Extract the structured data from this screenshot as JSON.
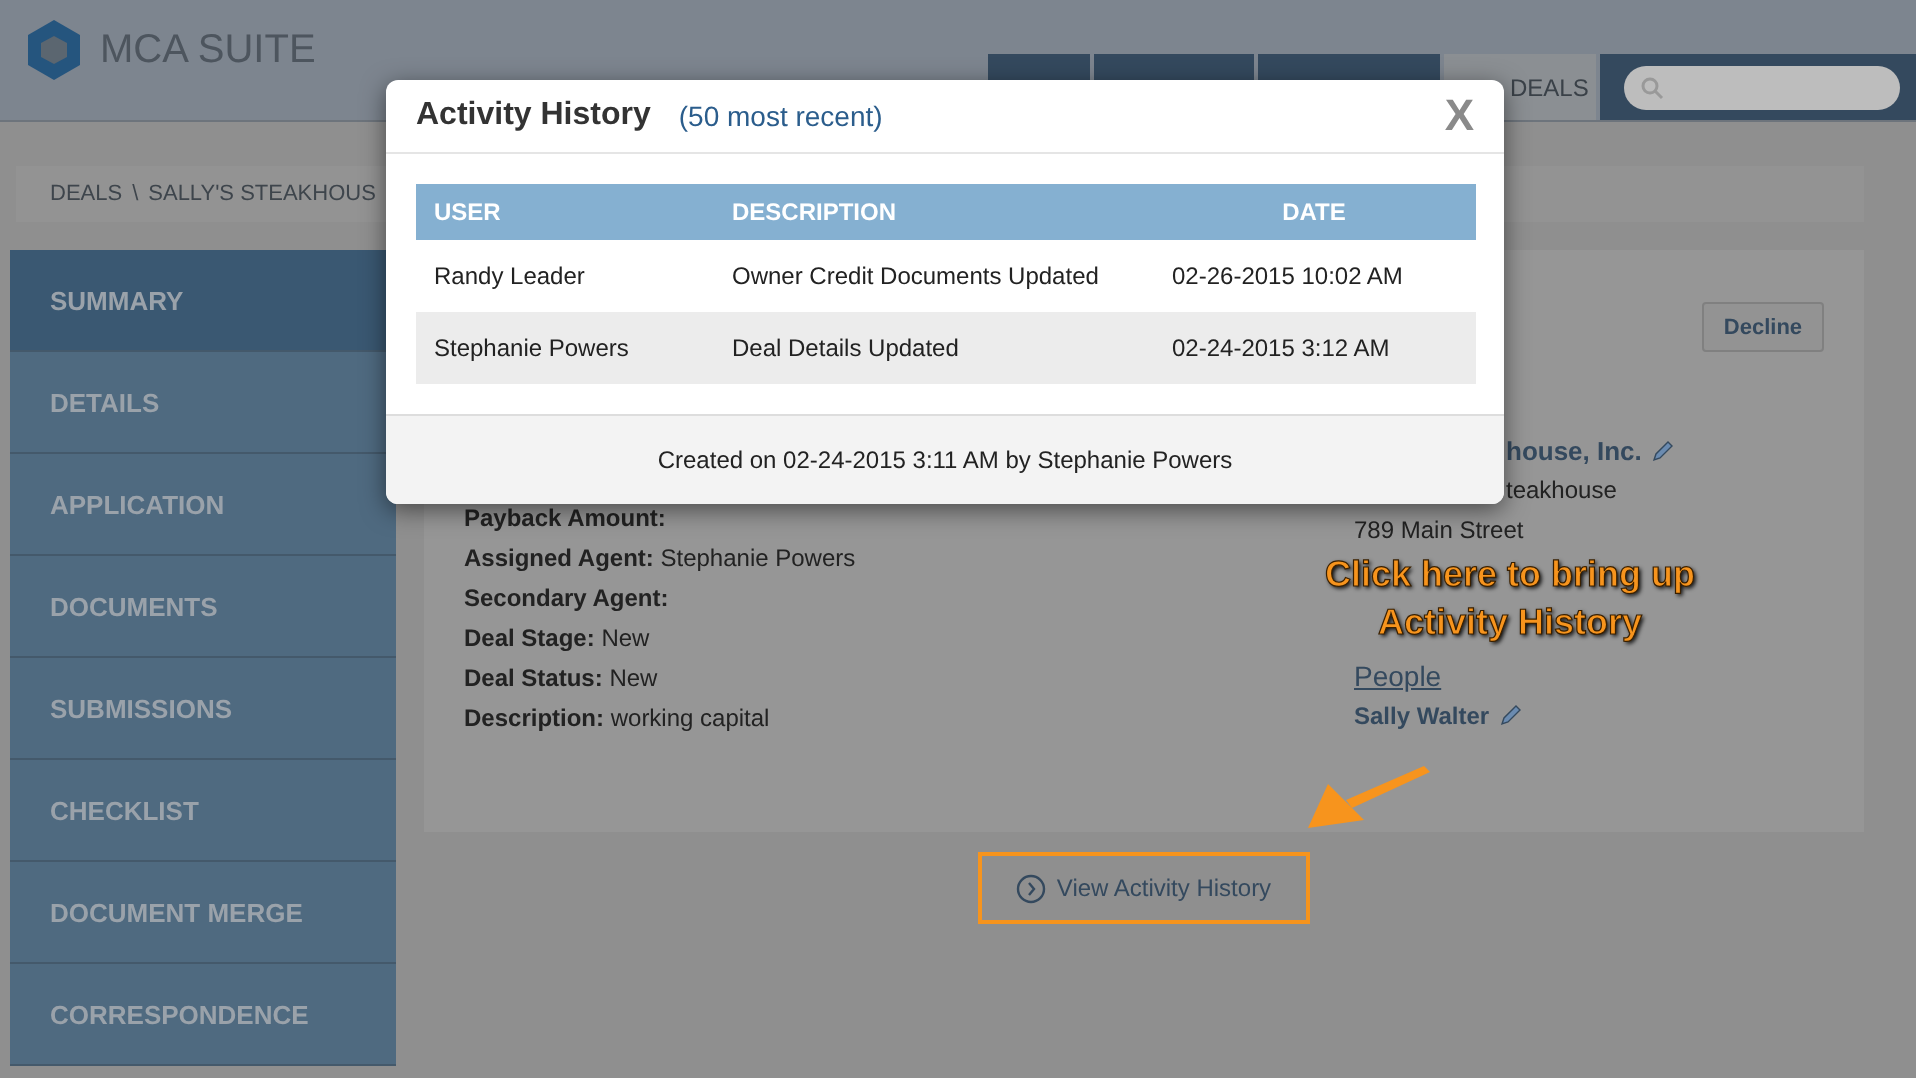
{
  "app": {
    "name": "MCA SUITE"
  },
  "nav_tabs": [
    {
      "selected": false
    },
    {
      "selected": false
    },
    {
      "selected": false
    },
    {
      "label": "DEALS",
      "selected": true
    }
  ],
  "breadcrumb": {
    "items": [
      "DEALS",
      "SALLY'S STEAKHOUS"
    ],
    "separator": "\\"
  },
  "sidebar": {
    "items": [
      {
        "label": "SUMMARY",
        "selected": true
      },
      {
        "label": "DETAILS",
        "selected": false
      },
      {
        "label": "APPLICATION",
        "selected": false
      },
      {
        "label": "DOCUMENTS",
        "selected": false
      },
      {
        "label": "SUBMISSIONS",
        "selected": false
      },
      {
        "label": "CHECKLIST",
        "selected": false
      },
      {
        "label": "DOCUMENT MERGE",
        "selected": false
      },
      {
        "label": "CORRESPONDENCE",
        "selected": false
      }
    ]
  },
  "deal": {
    "decline_button": "Decline",
    "fields": [
      {
        "label": "Payback Amount:"
      },
      {
        "label": "Assigned Agent:",
        "value": "Stephanie Powers"
      },
      {
        "label": "Secondary Agent:"
      },
      {
        "label": "Deal Stage:",
        "value": "New"
      },
      {
        "label": "Deal Status:",
        "value": "New"
      },
      {
        "label": "Description:",
        "value": "working capital"
      }
    ],
    "business_name": "house, Inc.",
    "business_lines": [
      "teakhouse",
      "789 Main Street"
    ],
    "people_link": "People",
    "contact": "Sally Walter"
  },
  "view_history_button": "View Activity History",
  "activity_history": {
    "title": "Activity History",
    "subtitle": "(50 most recent)",
    "close": "X",
    "columns": [
      "USER",
      "DESCRIPTION",
      "DATE"
    ],
    "rows": [
      [
        "Randy Leader",
        "Owner Credit Documents Updated",
        "02-26-2015 10:02 AM"
      ],
      [
        "Stephanie Powers",
        "Deal Details Updated",
        "02-24-2015 3:12 AM"
      ]
    ],
    "footer": "Created on 02-24-2015 3:11 AM by Stephanie Powers"
  },
  "callout": "Click here to bring up Activity History"
}
